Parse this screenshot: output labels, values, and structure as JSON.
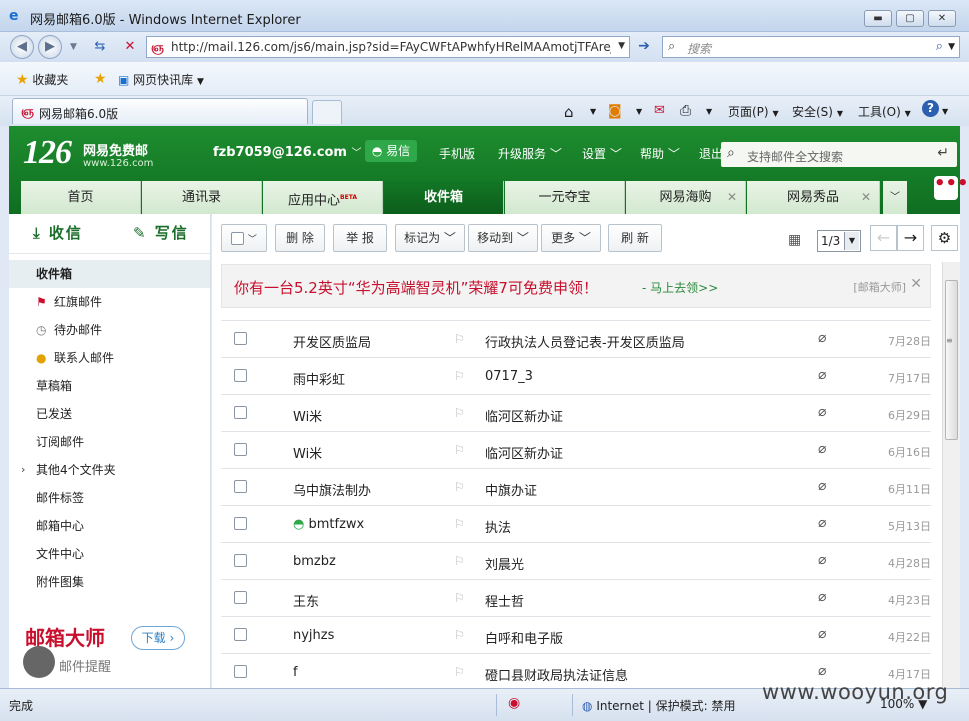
{
  "window": {
    "title": "网易邮箱6.0版 - Windows Internet Explorer",
    "min": "▬",
    "max": "▢",
    "close": "✕"
  },
  "addressbar": {
    "url": "http://mail.126.com/js6/main.jsp?sid=FAyCWFtAPwhfyHRelMAAmotjTFAreJzI",
    "search_placeholder": "搜索"
  },
  "favbar": {
    "favorites": "收藏夹",
    "quicklinks": "网页快讯库"
  },
  "tabs": {
    "active": "网易邮箱6.0版"
  },
  "commandbar": {
    "page": "页面(P)",
    "safety": "安全(S)",
    "tools": "工具(O)"
  },
  "mail": {
    "logo": "126",
    "logo_sub": "网易免费邮",
    "logo_url": "www.126.com",
    "account": "fzb7059@126.com",
    "yixin": "易信",
    "topnav": [
      "手机版",
      "升级服务",
      "设置",
      "帮助",
      "退出"
    ],
    "search_placeholder": "支持邮件全文搜索",
    "navtabs": [
      {
        "label": "首页"
      },
      {
        "label": "通讯录"
      },
      {
        "label": "应用中心",
        "badge": "BETA"
      },
      {
        "label": "收件箱"
      },
      {
        "label": "一元夺宝"
      },
      {
        "label": "网易海购"
      },
      {
        "label": "网易秀品"
      }
    ],
    "active_tab": "收件箱"
  },
  "sidebar": {
    "receive": "收信",
    "compose": "写信",
    "folders": [
      {
        "label": "收件箱",
        "icon": "none"
      },
      {
        "label": "红旗邮件",
        "icon": "red-flag-icon"
      },
      {
        "label": "待办邮件",
        "icon": "clock-icon"
      },
      {
        "label": "联系人邮件",
        "icon": "person-icon"
      },
      {
        "label": "草稿箱",
        "icon": "none"
      },
      {
        "label": "已发送",
        "icon": "none"
      },
      {
        "label": "订阅邮件",
        "icon": "none"
      },
      {
        "label": "其他4个文件夹",
        "icon": "caret-right-icon"
      },
      {
        "label": "邮件标签",
        "icon": "none"
      },
      {
        "label": "邮箱中心",
        "icon": "none"
      },
      {
        "label": "文件中心",
        "icon": "none"
      },
      {
        "label": "附件图集",
        "icon": "none"
      }
    ],
    "promo": "邮箱大师",
    "download": "下载",
    "remind": "邮件提醒"
  },
  "toolbar": {
    "delete": "删 除",
    "report": "举 报",
    "mark_as": "标记为",
    "move_to": "移动到",
    "more": "更多",
    "refresh": "刷 新",
    "page": "1/3"
  },
  "ad": {
    "text": "你有一台5.2英寸“华为高端智灵机”荣耀7可免费申领！",
    "link": "- 马上去领>>",
    "source": "[邮箱大师]"
  },
  "emails": [
    {
      "sender": "开发区质监局",
      "subject": "行政执法人员登记表-开发区质监局",
      "date": "7月28日",
      "yixin": false
    },
    {
      "sender": "雨中彩虹",
      "subject": "0717_3",
      "date": "7月17日",
      "yixin": false
    },
    {
      "sender": "Wi米",
      "subject": "临河区新办证",
      "date": "6月29日",
      "yixin": false
    },
    {
      "sender": "Wi米",
      "subject": "临河区新办证",
      "date": "6月16日",
      "yixin": false
    },
    {
      "sender": "乌中旗法制办",
      "subject": "中旗办证",
      "date": "6月11日",
      "yixin": false
    },
    {
      "sender": "bmtfzwx",
      "subject": "执法",
      "date": "5月13日",
      "yixin": true
    },
    {
      "sender": "bmzbz",
      "subject": "刘晨光",
      "date": "4月28日",
      "yixin": false
    },
    {
      "sender": "王东",
      "subject": "程士哲",
      "date": "4月23日",
      "yixin": false
    },
    {
      "sender": "nyjhzs",
      "subject": "白呼和电子版",
      "date": "4月22日",
      "yixin": false
    },
    {
      "sender": "f",
      "subject": "磴口县财政局执法证信息",
      "date": "4月17日",
      "yixin": false
    }
  ],
  "statusbar": {
    "status": "完成",
    "zone": "Internet | 保护模式: 禁用",
    "zoom": "100%"
  },
  "watermark": "www.wooyun.org"
}
